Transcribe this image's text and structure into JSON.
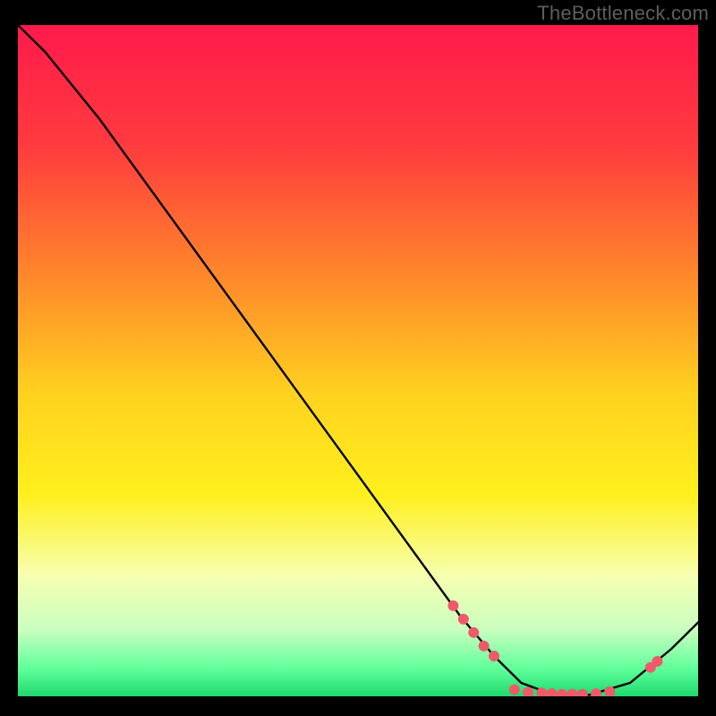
{
  "watermark": "TheBottleneck.com",
  "chart_data": {
    "type": "line",
    "title": "",
    "xlabel": "",
    "ylabel": "",
    "xlim": [
      0,
      100
    ],
    "ylim": [
      0,
      100
    ],
    "gradient_stops": [
      {
        "offset": 0,
        "color": "#ff1a4b"
      },
      {
        "offset": 18,
        "color": "#ff3b3e"
      },
      {
        "offset": 38,
        "color": "#ff8a2a"
      },
      {
        "offset": 55,
        "color": "#ffd21f"
      },
      {
        "offset": 70,
        "color": "#fff01e"
      },
      {
        "offset": 82,
        "color": "#f7ffb0"
      },
      {
        "offset": 90,
        "color": "#caffc0"
      },
      {
        "offset": 96,
        "color": "#5eff9a"
      },
      {
        "offset": 100,
        "color": "#1fd86e"
      }
    ],
    "curve": [
      {
        "x": 0,
        "y": 100
      },
      {
        "x": 4,
        "y": 96
      },
      {
        "x": 8,
        "y": 91
      },
      {
        "x": 12,
        "y": 86
      },
      {
        "x": 65,
        "y": 12
      },
      {
        "x": 70,
        "y": 6
      },
      {
        "x": 74,
        "y": 2
      },
      {
        "x": 78,
        "y": 0.5
      },
      {
        "x": 84,
        "y": 0.2
      },
      {
        "x": 90,
        "y": 2
      },
      {
        "x": 96,
        "y": 7
      },
      {
        "x": 100,
        "y": 11
      }
    ],
    "markers": [
      {
        "x": 64,
        "y": 13.5
      },
      {
        "x": 65.5,
        "y": 11.5
      },
      {
        "x": 67,
        "y": 9.5
      },
      {
        "x": 68.5,
        "y": 7.5
      },
      {
        "x": 70,
        "y": 6
      },
      {
        "x": 73,
        "y": 1
      },
      {
        "x": 75,
        "y": 0.6
      },
      {
        "x": 77,
        "y": 0.5
      },
      {
        "x": 78.5,
        "y": 0.4
      },
      {
        "x": 80,
        "y": 0.3
      },
      {
        "x": 81.5,
        "y": 0.3
      },
      {
        "x": 83,
        "y": 0.3
      },
      {
        "x": 85,
        "y": 0.4
      },
      {
        "x": 87,
        "y": 0.7
      },
      {
        "x": 93,
        "y": 4.3
      },
      {
        "x": 94,
        "y": 5.2
      }
    ],
    "marker_color": "#ef5a6a",
    "marker_radius": 6,
    "line_color": "#000000",
    "line_width": 2.4
  }
}
